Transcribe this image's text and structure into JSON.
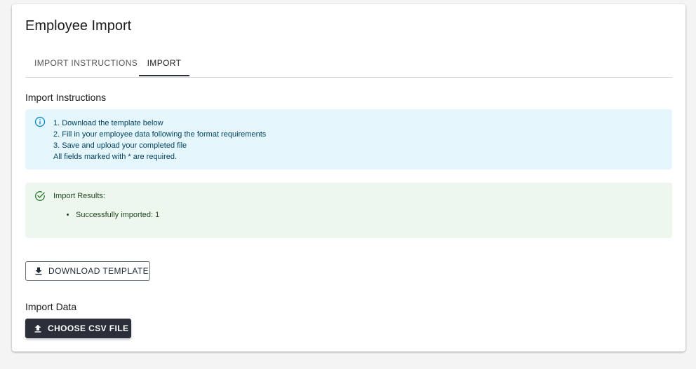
{
  "page": {
    "title": "Employee Import"
  },
  "tabs": [
    {
      "label": "IMPORT INSTRUCTIONS",
      "active": false
    },
    {
      "label": "IMPORT",
      "active": true
    }
  ],
  "instructions": {
    "heading": "Import Instructions",
    "icon": "info-icon",
    "lines": [
      "1. Download the template below",
      "2. Fill in your employee data following the format requirements",
      "3. Save and upload your completed file",
      "All fields marked with * are required."
    ]
  },
  "results": {
    "icon": "check-circle-icon",
    "title": "Import Results:",
    "items": [
      "Successfully imported: 1"
    ]
  },
  "buttons": {
    "download_template": "DOWNLOAD TEMPLATE",
    "download_icon": "download-icon",
    "choose_csv": "CHOOSE CSV FILE",
    "upload_icon": "upload-icon"
  },
  "import_data": {
    "label": "Import Data"
  },
  "colors": {
    "info_bg": "#e5f6fd",
    "info_fg": "#014361",
    "info_icon": "#0288d1",
    "success_bg": "#edf7ed",
    "success_fg": "#1e4620",
    "success_icon": "#2e7d32",
    "primary_dark": "#2a2f3a"
  }
}
